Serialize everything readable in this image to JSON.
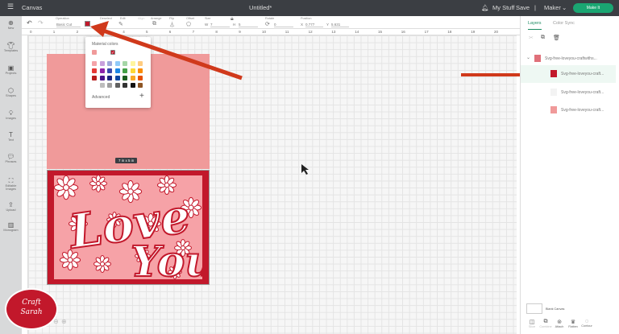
{
  "topbar": {
    "menu_icon": "hamburger-icon",
    "title": "Canvas",
    "doc_title": "Untitled*",
    "my_stuff": "My Stuff",
    "save": "Save",
    "separator": "|",
    "machine": "Maker",
    "make_it": "Make It"
  },
  "toolbar": {
    "operation_label": "Operation",
    "operation_value": "Basic Cut",
    "color": "#c2182b",
    "deselect": "Deselect",
    "edit": "Edit",
    "align": "Align",
    "arrange": "Arrange",
    "flip": "Flip",
    "offset": "Offset",
    "size": "Size",
    "w_label": "W",
    "w_value": "7",
    "h_label": "H",
    "h_value": "5",
    "rotate": "Rotate",
    "rotate_value": "0",
    "position": "Position",
    "x_label": "X",
    "x_value": "0.777",
    "y_label": "Y",
    "y_value": "5.631"
  },
  "sidebar": [
    {
      "label": "New",
      "icon": "plus-circle-icon"
    },
    {
      "label": "Templates",
      "icon": "shirt-icon"
    },
    {
      "label": "Projects",
      "icon": "projects-icon"
    },
    {
      "label": "Shapes",
      "icon": "shapes-icon"
    },
    {
      "label": "Images",
      "icon": "lightbulb-icon"
    },
    {
      "label": "Text",
      "icon": "text-icon"
    },
    {
      "label": "Phrases",
      "icon": "speech-icon"
    },
    {
      "label": "Editable Images",
      "icon": "editable-icon"
    },
    {
      "label": "Upload",
      "icon": "upload-icon"
    },
    {
      "label": "Monogram",
      "icon": "monogram-icon"
    }
  ],
  "ruler": [
    "0",
    "1",
    "2",
    "3",
    "4",
    "5",
    "6",
    "7",
    "8",
    "9",
    "10",
    "11",
    "12",
    "13",
    "14",
    "15",
    "16",
    "17",
    "18",
    "19",
    "20"
  ],
  "canvas": {
    "size_label": "7 in x 5 in",
    "design_text": "Love You"
  },
  "popup": {
    "title": "Material colors",
    "advanced": "Advanced",
    "add": "+",
    "recent": [
      "#f09a9a",
      "#c2182b"
    ],
    "swatches": [
      "#f4a3a8",
      "#c9a0dc",
      "#9fa8da",
      "#90caf9",
      "#a5d6a7",
      "#fff59d",
      "#ffcc80",
      "#e53935",
      "#8e24aa",
      "#3949ab",
      "#1e88e5",
      "#43a047",
      "#fdd835",
      "#fb8c00",
      "#b71c1c",
      "#4a148c",
      "#1a237e",
      "#0d47a1",
      "#1b5e20",
      "#f9a825",
      "#e65100",
      "#ffffff",
      "#bdbdbd",
      "#9e9e9e",
      "#616161",
      "#333333",
      "#111111",
      "#8d5524"
    ]
  },
  "panel": {
    "tab_layers": "Layers",
    "tab_colorsync": "Color Sync",
    "layers": [
      {
        "name": "Svg-free-loveyou-craftwiths...",
        "color": "#e0707a"
      },
      {
        "name": "Svg-free-loveyou-craft...",
        "color": "#c2182b"
      },
      {
        "name": "Svg-free-loveyou-craft...",
        "color": "#f3f3f3"
      },
      {
        "name": "Svg-free-loveyou-craft...",
        "color": "#f09a9a"
      }
    ],
    "blank_canvas": "Blank Canvas",
    "bottom": [
      "Slice",
      "Combine",
      "Attach",
      "Flatten",
      "Contour"
    ]
  },
  "logo": {
    "text": "Craft with Sarah"
  }
}
